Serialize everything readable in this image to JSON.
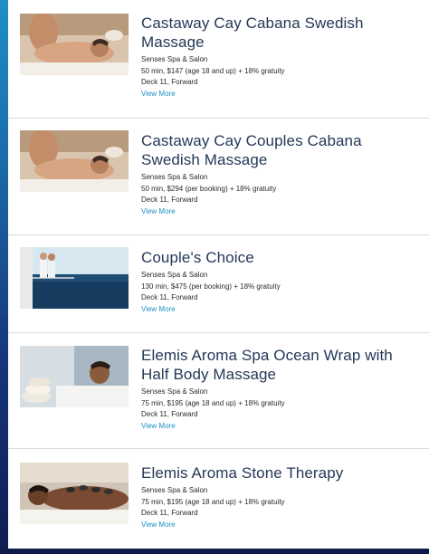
{
  "items": [
    {
      "title": "Castaway Cay Cabana Swedish Massage",
      "venue": "Senses Spa & Salon",
      "details": "50 min, $147 (age 18 and up) + 18% gratuity",
      "location": "Deck 11, Forward",
      "link": "View More",
      "image": "massage-cabana-photo"
    },
    {
      "title": "Castaway Cay Couples Cabana Swedish Massage",
      "venue": "Senses Spa & Salon",
      "details": "50 min, $294 (per booking) + 18% gratuity",
      "location": "Deck 11, Forward",
      "link": "View More",
      "image": "couples-massage-photo"
    },
    {
      "title": "Couple's Choice",
      "venue": "Senses Spa & Salon",
      "details": "130 min, $475 (per booking) + 18% gratuity",
      "location": "Deck 11, Forward",
      "link": "View More",
      "image": "ocean-balcony-photo"
    },
    {
      "title": "Elemis Aroma Spa Ocean Wrap with Half Body Massage",
      "venue": "Senses Spa & Salon",
      "details": "75 min, $195 (age 18 and up) + 18% gratuity",
      "location": "Deck 11, Forward",
      "link": "View More",
      "image": "spa-wrap-photo"
    },
    {
      "title": "Elemis Aroma Stone Therapy",
      "venue": "Senses Spa & Salon",
      "details": "75 min, $195 (age 18 and up) + 18% gratuity",
      "location": "Deck 11, Forward",
      "link": "View More",
      "image": "stone-therapy-photo"
    }
  ],
  "colors": {
    "title": "#253858",
    "link": "#1e8fc7",
    "divider": "#dcdcdc",
    "sidebar_gradient_top": "#1f8fc6",
    "sidebar_gradient_bottom": "#0f1c52"
  }
}
